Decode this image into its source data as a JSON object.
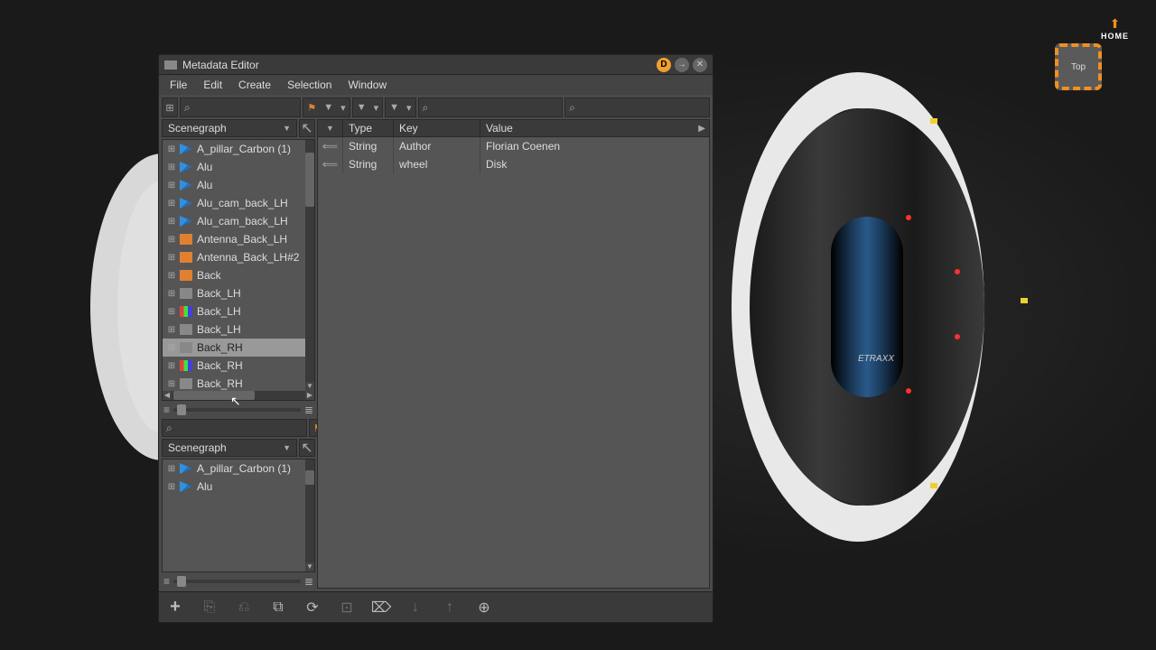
{
  "home_widget": {
    "label": "HOME"
  },
  "orientation_cube": {
    "face": "Top"
  },
  "window": {
    "title": "Metadata Editor",
    "d_badge": "D"
  },
  "menu": {
    "file": "File",
    "edit": "Edit",
    "create": "Create",
    "selection": "Selection",
    "window": "Window"
  },
  "scenegraph_dropdown": {
    "label": "Scenegraph"
  },
  "tree_top": {
    "items": [
      {
        "label": "A_pillar_Carbon (1)",
        "flag": "blue"
      },
      {
        "label": "Alu",
        "flag": "blue"
      },
      {
        "label": "Alu",
        "flag": "blue"
      },
      {
        "label": "Alu_cam_back_LH",
        "flag": "blue"
      },
      {
        "label": "Alu_cam_back_LH",
        "flag": "blue"
      },
      {
        "label": "Antenna_Back_LH",
        "flag": "orange"
      },
      {
        "label": "Antenna_Back_LH#2",
        "flag": "orange"
      },
      {
        "label": "Back",
        "flag": "orange"
      },
      {
        "label": "Back_LH",
        "flag": "gray"
      },
      {
        "label": "Back_LH",
        "flag": "multi"
      },
      {
        "label": "Back_LH",
        "flag": "gray"
      },
      {
        "label": "Back_RH",
        "flag": "gray",
        "selected": true
      },
      {
        "label": "Back_RH",
        "flag": "multi"
      },
      {
        "label": "Back_RH",
        "flag": "gray"
      }
    ]
  },
  "tree_bottom": {
    "items": [
      {
        "label": "A_pillar_Carbon (1)",
        "flag": "blue"
      },
      {
        "label": "Alu",
        "flag": "blue"
      }
    ]
  },
  "meta_table": {
    "headers": {
      "type": "Type",
      "key": "Key",
      "value": "Value"
    },
    "rows": [
      {
        "type": "String",
        "key": "Author",
        "value": "Florian Coenen"
      },
      {
        "type": "String",
        "key": "wheel",
        "value": "Disk"
      }
    ]
  },
  "viewport": {
    "brand_label": "ETRAXX"
  }
}
